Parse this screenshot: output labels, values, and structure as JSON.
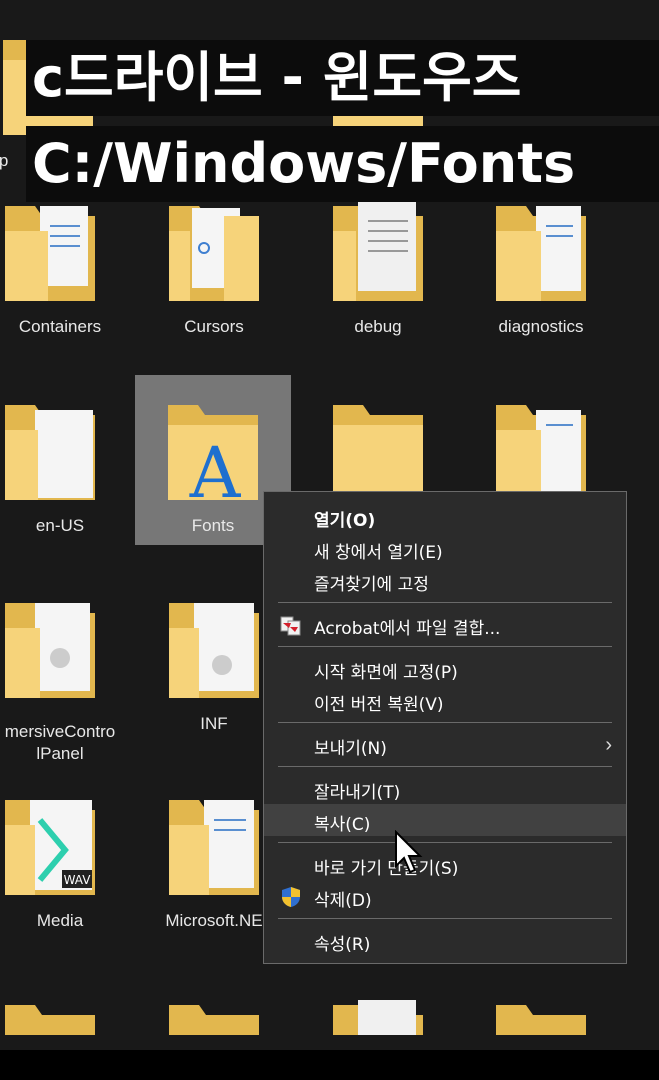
{
  "overlay": {
    "line1": "c드라이브 - 윈도우즈",
    "line2": "C:/Windows/Fonts"
  },
  "folders": [
    {
      "label": "app",
      "partial": true
    },
    {
      "label": "...",
      "partial": true
    },
    {
      "label": "Containers"
    },
    {
      "label": "Cursors"
    },
    {
      "label": "debug"
    },
    {
      "label": "diagnostics"
    },
    {
      "label": "en-US"
    },
    {
      "label": "Fonts",
      "selected": true
    },
    {
      "label": "ImmersiveControlPanel",
      "display": "mersiveContro\nlPanel"
    },
    {
      "label": "INF"
    },
    {
      "label": "Media"
    },
    {
      "label": "Microsoft.NET",
      "display": "Microsoft.NE"
    }
  ],
  "context_menu": {
    "open": "열기(O)",
    "open_new_window": "새 창에서 열기(E)",
    "pin_quick_access": "즐겨찾기에 고정",
    "acrobat_combine": "Acrobat에서 파일 결합...",
    "pin_start": "시작 화면에 고정(P)",
    "restore_previous": "이전 버전 복원(V)",
    "send_to": "보내기(N)",
    "cut": "잘라내기(T)",
    "copy": "복사(C)",
    "create_shortcut": "바로 가기 만들기(S)",
    "delete": "삭제(D)",
    "properties": "속성(R)"
  },
  "colors": {
    "background": "#191919",
    "menu_bg": "#2b2b2b",
    "menu_hover": "#414141",
    "folder_yellow": "#f6d37a",
    "folder_dark": "#e2b74e",
    "selection": "#777777"
  }
}
